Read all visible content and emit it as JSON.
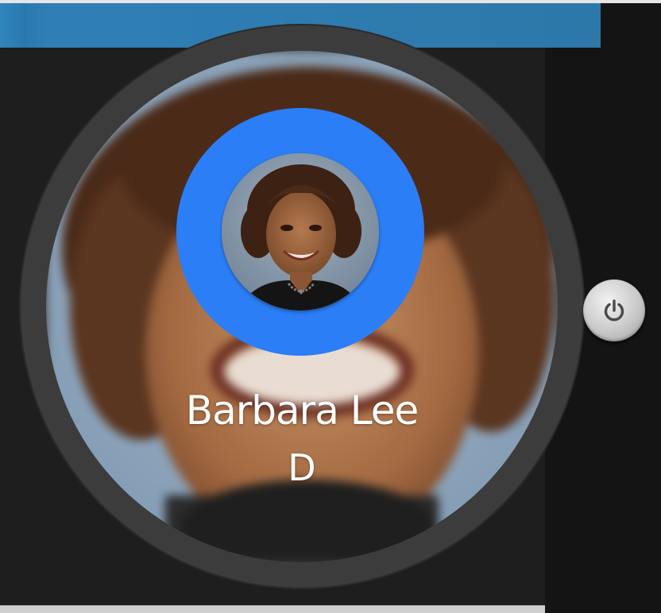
{
  "window": {
    "title_bar_color": "#2f7fb6"
  },
  "watch": {
    "contact": {
      "name": "Barbara Lee",
      "party": "D",
      "avatar": "portrait-photo"
    },
    "ring_color": "#2b7ef6"
  },
  "controls": {
    "power_button_icon": "power-icon"
  }
}
